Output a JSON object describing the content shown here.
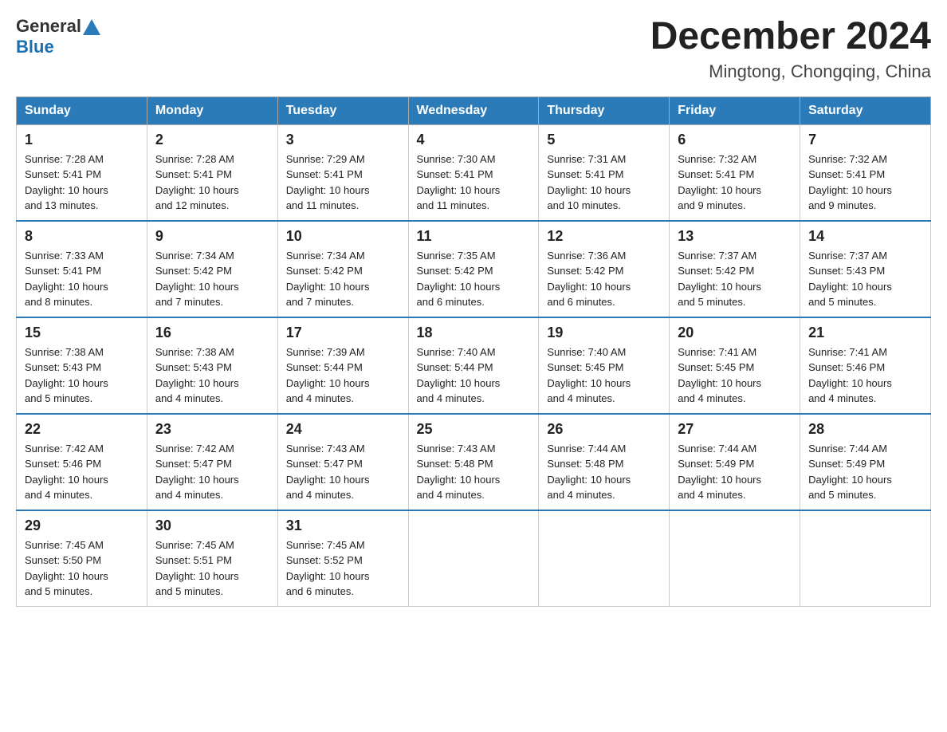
{
  "header": {
    "logo_general": "General",
    "logo_blue": "Blue",
    "month_title": "December 2024",
    "location": "Mingtong, Chongqing, China"
  },
  "weekdays": [
    "Sunday",
    "Monday",
    "Tuesday",
    "Wednesday",
    "Thursday",
    "Friday",
    "Saturday"
  ],
  "weeks": [
    [
      {
        "day": "1",
        "sunrise": "7:28 AM",
        "sunset": "5:41 PM",
        "daylight": "10 hours and 13 minutes."
      },
      {
        "day": "2",
        "sunrise": "7:28 AM",
        "sunset": "5:41 PM",
        "daylight": "10 hours and 12 minutes."
      },
      {
        "day": "3",
        "sunrise": "7:29 AM",
        "sunset": "5:41 PM",
        "daylight": "10 hours and 11 minutes."
      },
      {
        "day": "4",
        "sunrise": "7:30 AM",
        "sunset": "5:41 PM",
        "daylight": "10 hours and 11 minutes."
      },
      {
        "day": "5",
        "sunrise": "7:31 AM",
        "sunset": "5:41 PM",
        "daylight": "10 hours and 10 minutes."
      },
      {
        "day": "6",
        "sunrise": "7:32 AM",
        "sunset": "5:41 PM",
        "daylight": "10 hours and 9 minutes."
      },
      {
        "day": "7",
        "sunrise": "7:32 AM",
        "sunset": "5:41 PM",
        "daylight": "10 hours and 9 minutes."
      }
    ],
    [
      {
        "day": "8",
        "sunrise": "7:33 AM",
        "sunset": "5:41 PM",
        "daylight": "10 hours and 8 minutes."
      },
      {
        "day": "9",
        "sunrise": "7:34 AM",
        "sunset": "5:42 PM",
        "daylight": "10 hours and 7 minutes."
      },
      {
        "day": "10",
        "sunrise": "7:34 AM",
        "sunset": "5:42 PM",
        "daylight": "10 hours and 7 minutes."
      },
      {
        "day": "11",
        "sunrise": "7:35 AM",
        "sunset": "5:42 PM",
        "daylight": "10 hours and 6 minutes."
      },
      {
        "day": "12",
        "sunrise": "7:36 AM",
        "sunset": "5:42 PM",
        "daylight": "10 hours and 6 minutes."
      },
      {
        "day": "13",
        "sunrise": "7:37 AM",
        "sunset": "5:42 PM",
        "daylight": "10 hours and 5 minutes."
      },
      {
        "day": "14",
        "sunrise": "7:37 AM",
        "sunset": "5:43 PM",
        "daylight": "10 hours and 5 minutes."
      }
    ],
    [
      {
        "day": "15",
        "sunrise": "7:38 AM",
        "sunset": "5:43 PM",
        "daylight": "10 hours and 5 minutes."
      },
      {
        "day": "16",
        "sunrise": "7:38 AM",
        "sunset": "5:43 PM",
        "daylight": "10 hours and 4 minutes."
      },
      {
        "day": "17",
        "sunrise": "7:39 AM",
        "sunset": "5:44 PM",
        "daylight": "10 hours and 4 minutes."
      },
      {
        "day": "18",
        "sunrise": "7:40 AM",
        "sunset": "5:44 PM",
        "daylight": "10 hours and 4 minutes."
      },
      {
        "day": "19",
        "sunrise": "7:40 AM",
        "sunset": "5:45 PM",
        "daylight": "10 hours and 4 minutes."
      },
      {
        "day": "20",
        "sunrise": "7:41 AM",
        "sunset": "5:45 PM",
        "daylight": "10 hours and 4 minutes."
      },
      {
        "day": "21",
        "sunrise": "7:41 AM",
        "sunset": "5:46 PM",
        "daylight": "10 hours and 4 minutes."
      }
    ],
    [
      {
        "day": "22",
        "sunrise": "7:42 AM",
        "sunset": "5:46 PM",
        "daylight": "10 hours and 4 minutes."
      },
      {
        "day": "23",
        "sunrise": "7:42 AM",
        "sunset": "5:47 PM",
        "daylight": "10 hours and 4 minutes."
      },
      {
        "day": "24",
        "sunrise": "7:43 AM",
        "sunset": "5:47 PM",
        "daylight": "10 hours and 4 minutes."
      },
      {
        "day": "25",
        "sunrise": "7:43 AM",
        "sunset": "5:48 PM",
        "daylight": "10 hours and 4 minutes."
      },
      {
        "day": "26",
        "sunrise": "7:44 AM",
        "sunset": "5:48 PM",
        "daylight": "10 hours and 4 minutes."
      },
      {
        "day": "27",
        "sunrise": "7:44 AM",
        "sunset": "5:49 PM",
        "daylight": "10 hours and 4 minutes."
      },
      {
        "day": "28",
        "sunrise": "7:44 AM",
        "sunset": "5:49 PM",
        "daylight": "10 hours and 5 minutes."
      }
    ],
    [
      {
        "day": "29",
        "sunrise": "7:45 AM",
        "sunset": "5:50 PM",
        "daylight": "10 hours and 5 minutes."
      },
      {
        "day": "30",
        "sunrise": "7:45 AM",
        "sunset": "5:51 PM",
        "daylight": "10 hours and 5 minutes."
      },
      {
        "day": "31",
        "sunrise": "7:45 AM",
        "sunset": "5:52 PM",
        "daylight": "10 hours and 6 minutes."
      },
      null,
      null,
      null,
      null
    ]
  ],
  "labels": {
    "sunrise": "Sunrise:",
    "sunset": "Sunset:",
    "daylight": "Daylight:"
  }
}
